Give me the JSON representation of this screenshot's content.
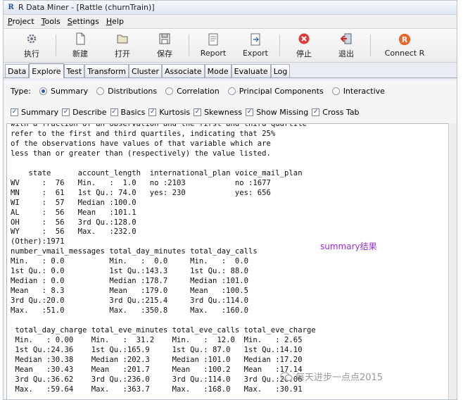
{
  "window": {
    "title": "R Data Miner - [Rattle (churnTrain)]"
  },
  "menu": [
    {
      "label": "Project",
      "ul": "P",
      "rest": "roject"
    },
    {
      "label": "Tools",
      "ul": "T",
      "rest": "ools"
    },
    {
      "label": "Settings",
      "ul": "S",
      "rest": "ettings"
    },
    {
      "label": "Help",
      "ul": "H",
      "rest": "elp"
    }
  ],
  "toolbar": {
    "execute_label": "执行",
    "new_label": "新建",
    "open_label": "打开",
    "save_label": "保存",
    "report_label": "Report",
    "export_label": "Export",
    "stop_label": "停止",
    "quit_label": "退出",
    "connect_label": "Connect R",
    "icons": [
      "gears-icon",
      "new-file-icon",
      "open-folder-icon",
      "save-disk-icon",
      "report-icon",
      "export-icon",
      "stop-icon",
      "quit-icon",
      "r-logo-icon"
    ]
  },
  "tabs": [
    "Data",
    "Explore",
    "Test",
    "Transform",
    "Cluster",
    "Associate",
    "Mode",
    "Evaluate",
    "Log"
  ],
  "active_tab": "Explore",
  "type_row": {
    "label": "Type:",
    "options": [
      "Summary",
      "Distributions",
      "Correlation",
      "Principal Components",
      "Interactive"
    ],
    "selected": "Summary"
  },
  "checks": [
    "Summary",
    "Describe",
    "Basics",
    "Kurtosis",
    "Skewness",
    "Show Missing",
    "Cross Tab"
  ],
  "output_text": "with a fraction of an observation and the first and third quartile\nrefer to the first and third quartiles, indicating that 25%\nof the observations have values of that variable which are\nless than or greater than (respectively) the value listed.\n\n    state      account_length  international_plan voice_mail_plan\nWV     :  76   Min.   :  1.0   no :2103           no :1677       \nMN     :  61   1st Qu.: 74.0   yes: 230           yes: 656       \nWI     :  57   Median :100.0                                     \nAL     :  56   Mean   :101.1                                     \nOH     :  56   3rd Qu.:128.0                                     \nWY     :  56   Max.   :232.0                                     \n(Other):1971                                                     \nnumber_vmail_messages total_day_minutes total_day_calls\nMin.   : 0.0          Min.   :  0.0     Min.   :  0.0  \n1st Qu.: 0.0          1st Qu.:143.3     1st Qu.: 88.0  \nMedian : 0.0          Median :178.7     Median :101.0  \nMean   : 8.3          Mean   :179.0     Mean   :100.5  \n3rd Qu.:20.0          3rd Qu.:215.4     3rd Qu.:114.0  \nMax.   :51.0          Max.   :350.8     Max.   :160.0  \n\n total_day_charge total_eve_minutes total_eve_calls total_eve_charge\n Min.   : 0.00    Min.   :  31.2    Min.   :  12.0  Min.   : 2.65   \n 1st Qu.:24.36    1st Qu.:165.9     1st Qu.: 87.0   1st Qu.:14.10   \n Median :30.38    Median :202.3     Median :101.0   Median :17.20   \n Mean   :30.43    Mean   :201.7     Mean   :100.2   Mean   :17.14   \n 3rd Qu.:36.62    3rd Qu.:236.0     3rd Qu.:114.0   3rd Qu.:20.06   \n Max.   :59.64    Max.   :363.7     Max.   :168.0   Max.   :30.91   ",
  "annotation": "summary结果",
  "watermark": "每天进步一点点2015"
}
